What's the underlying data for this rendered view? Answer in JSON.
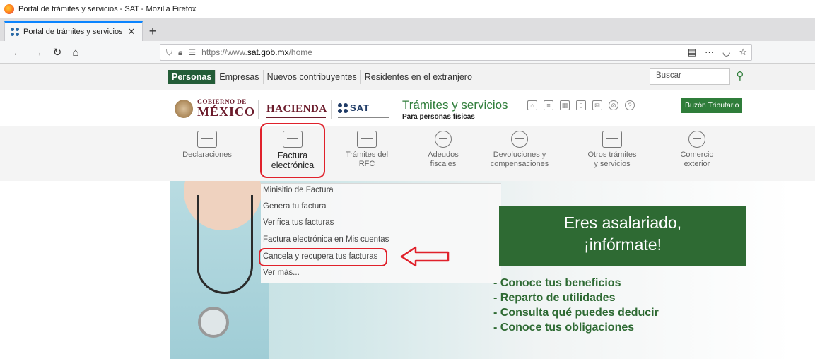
{
  "window": {
    "title": "Portal de trámites y servicios - SAT - Mozilla Firefox"
  },
  "tab": {
    "title": "Portal de trámites y servicios – S",
    "close": "✕",
    "new_tab": "+"
  },
  "navbar": {
    "url_prefix": "https://www.",
    "url_host": "sat.gob.mx",
    "url_path": "/home"
  },
  "site": {
    "audience_tabs": [
      "Personas",
      "Empresas",
      "Nuevos contribuyentes",
      "Residentes en el extranjero"
    ],
    "search_placeholder": "Buscar",
    "gobierno_small": "GOBIERNO DE",
    "gobierno_big": "MÉXICO",
    "hacienda": "HACIENDA",
    "sat": "SAT",
    "tramites_title": "Trámites y servicios",
    "tramites_sub": "Para personas físicas",
    "buzon": "Buzón Tributario",
    "categories": [
      {
        "label": "Declaraciones"
      },
      {
        "label": "Factura\nelectrónica"
      },
      {
        "label": "Trámites del\nRFC"
      },
      {
        "label": "Adeudos\nfiscales"
      },
      {
        "label": "Devoluciones y\ncompensaciones"
      },
      {
        "label": "Otros trámites\ny servicios"
      },
      {
        "label": "Comercio\nexterior"
      }
    ],
    "dropdown": [
      "Minisitio de Factura",
      "Genera tu factura",
      "Verifica tus facturas",
      "Factura electrónica en Mis cuentas",
      "Cancela y recupera tus facturas",
      "Ver más..."
    ],
    "promo": {
      "line1": "Eres asalariado,",
      "line2": "¡infórmate!",
      "bullets": [
        "- Conoce tus beneficios",
        "- Reparto de utilidades",
        "- Consulta qué puedes deducir",
        "- Conoce tus obligaciones"
      ]
    }
  },
  "colors": {
    "green": "#2e6a33",
    "guinda": "#6b1b2b",
    "highlight": "#e0212b"
  }
}
